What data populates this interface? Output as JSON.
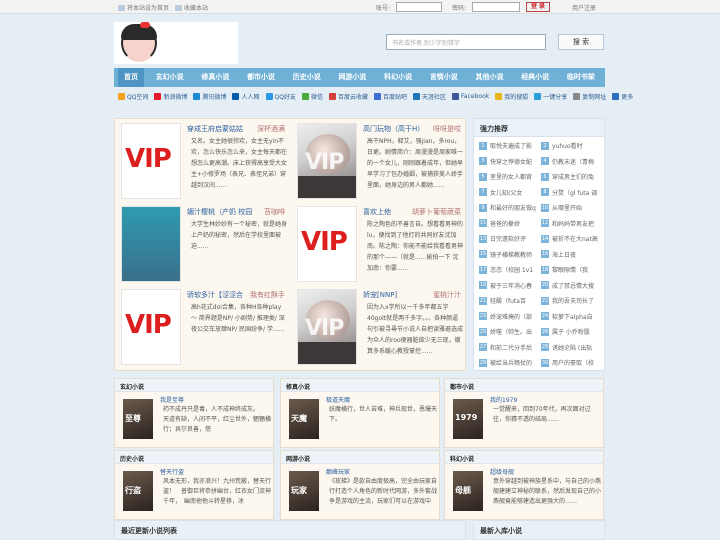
{
  "topbar": {
    "set_home": "将本站设为首页",
    "bookmark": "收藏本站",
    "account_label": "账号:",
    "password_label": "密码:",
    "login_button": "登 录",
    "register": "用户注册"
  },
  "search": {
    "placeholder": "书名或作者,别少字别错字",
    "button": "搜 索"
  },
  "nav": [
    "首页",
    "玄幻小说",
    "修真小说",
    "都市小说",
    "历史小说",
    "网游小说",
    "科幻小说",
    "言情小说",
    "其他小说",
    "经典小说",
    "临时书架"
  ],
  "share": [
    {
      "label": "QQ空间",
      "color": "#f4a21a"
    },
    {
      "label": "新浪微博",
      "color": "#e6162d"
    },
    {
      "label": "腾讯微博",
      "color": "#1a8ad4"
    },
    {
      "label": "人人网",
      "color": "#005eac"
    },
    {
      "label": "QQ好友",
      "color": "#2c9be6"
    },
    {
      "label": "微信",
      "color": "#4aa93d"
    },
    {
      "label": "百度云收藏",
      "color": "#d43e3e"
    },
    {
      "label": "百度贴吧",
      "color": "#3b6fd1"
    },
    {
      "label": "天涯社区",
      "color": "#2173b4"
    },
    {
      "label": "Facebook",
      "color": "#3b5998"
    },
    {
      "label": "我的搜狐",
      "color": "#e5b41a"
    },
    {
      "label": "一键分享",
      "color": "#2aa0d8"
    },
    {
      "label": "复制网址",
      "color": "#888888"
    },
    {
      "label": "更多",
      "color": "#2a6fbf"
    }
  ],
  "featured": [
    {
      "title": "穿成王府启蒙姑姑",
      "author": "深杯酒满",
      "desc": "又名。女主她很弥欢，女主无yin不欢，怎么快乐怎么来，女主每天都在想怎么更高潮。床上获得高享受大女主+小修罗场（表兄、表侄兄弟）穿越到汉间......",
      "cover": "vip"
    },
    {
      "title": "高门玩物（高干H）",
      "author": "呀呀是哎",
      "desc": "高干NPH，释艾，强jian，多rou，日更。剧情简介：周漫漫是周家唯一的一个女儿，刚刚跟着成年，但她早早学习了包办婚姻，被捕获美人娇手里面，她身边的男人都她......",
      "cover": "vipphoto"
    },
    {
      "title": "媚汁樱桃（产奶 校园",
      "author": "苔咖啡",
      "desc": "大学生林妙妙有一个秘密，就是她身上产奶的秘密，然后在学校里面被迫......",
      "cover": "green"
    },
    {
      "title": "喜欢上他",
      "author": "胡萝卜葡萄蔬菜",
      "desc": "陈之陶色的不善言自。想看看男神的lu，便找到了他打的共同好友沈加南。陈之陶：你能不能给我看看男神的那个——（就是......偷拍一下 沈加南：你要......",
      "cover": "vip"
    },
    {
      "title": "骄软多汁【涩涩合",
      "author": "我有红酥手",
      "desc": "高h花式doi合集，各种H各种play～ 简界题是NP/ 小剧势/ 推理类/ 深夜公交车放肆NP/ 民国纷争/ 学......",
      "cover": "vip"
    },
    {
      "title": "娇宠[NNP]",
      "author": "蜜桃汁汁",
      "desc": "因为入x学所以一千多年都五字40golt就是两千多字。。。各种颜逼句引被寻尋节小说人自把读雅避选成为众人的roo便器脏欲少无三现，徹算多系暖心教授掌控......",
      "cover": "vipphoto"
    }
  ],
  "recommend": {
    "title": "强力推荐",
    "items": [
      {
        "n": "1",
        "t": "取悦夫遍成了影"
      },
      {
        "n": "2",
        "t": "yuhuo看时"
      },
      {
        "n": "3",
        "t": "快穿之悖德女配"
      },
      {
        "n": "4",
        "t": "仍教未迷（青梅"
      },
      {
        "n": "5",
        "t": "室里的女人都背"
      },
      {
        "n": "6",
        "t": "穿成男主们的兔"
      },
      {
        "n": "7",
        "t": "女儿知(父女"
      },
      {
        "n": "8",
        "t": "分赘（gl futa 调"
      },
      {
        "n": "9",
        "t": "和最好的朋友做q"
      },
      {
        "n": "10",
        "t": "从哪里开始"
      },
      {
        "n": "11",
        "t": "爸爸的豢娇"
      },
      {
        "n": "12",
        "t": "和妈妈带男友把"
      },
      {
        "n": "13",
        "t": "日完遗软好评"
      },
      {
        "n": "14",
        "t": "被折不在大nat高"
      },
      {
        "n": "15",
        "t": "镜子横梯教教师"
      },
      {
        "n": "16",
        "t": "海上日夜"
      },
      {
        "n": "17",
        "t": "恣恣（校园 1v1"
      },
      {
        "n": "18",
        "t": "黎眼隙情（我"
      },
      {
        "n": "19",
        "t": "被于三年消心春"
      },
      {
        "n": "20",
        "t": "成了禁忌情大搜"
      },
      {
        "n": "21",
        "t": "轻酸（futa百"
      },
      {
        "n": "22",
        "t": "我的吾夫司长了"
      },
      {
        "n": "23",
        "t": "娇宠难掩的（部"
      },
      {
        "n": "24",
        "t": "软萝下alpha自"
      },
      {
        "n": "25",
        "t": "娇噬（帅生。出"
      },
      {
        "n": "26",
        "t": "属于 小乔粉骰"
      },
      {
        "n": "27",
        "t": "和前二代分手后"
      },
      {
        "n": "28",
        "t": "诱她沦陷 (出轨"
      },
      {
        "n": "29",
        "t": "被给当兵畅仗的"
      },
      {
        "n": "30",
        "t": "用户的豪取（校"
      }
    ]
  },
  "categories": [
    {
      "head": "玄幻小说",
      "title": "我是至尊",
      "desc": "药不成丹只是毒，人不成神终成灰。　　　天道有缺，人间不平，红尘世外，魍魉横行；哀尔良善，怒",
      "cover": "至尊"
    },
    {
      "head": "修真小说",
      "title": "极道天魔",
      "desc": "妖魔横行，世人苦难，神兵现世，恩爆天下。",
      "cover": "天魔"
    },
    {
      "head": "都市小说",
      "title": "我的1979",
      "desc": "一觉醒来，回到70年代，再次面对过往，你猜不透的结局……",
      "cover": "1979"
    },
    {
      "head": "历史小说",
      "title": "替天行盗",
      "desc": "风本无形，我亦浪兴！九州荒蔽，替天行盗！　普御巨将恭拼幽台，红衣女门流神千年，　幽南他他斗转星移，冰",
      "cover": "行盗"
    },
    {
      "head": "网游小说",
      "title": "巅峰玩家",
      "desc": "《玫梯》是款自由度极高，完全由玩家自行打造个人角色的新时代网游，多外套战争是游戏的主流，玩家们可以在游戏中",
      "cover": "玩家"
    },
    {
      "head": "科幻小说",
      "title": "超级母舰",
      "desc": "意外穿越到被神族星系中，与自己的小燕舰建建立神秘的联系，然后发现自己的小燕舰竟能够建造出更强大的……",
      "cover": "母舰"
    }
  ],
  "bottom": {
    "latest": "最近更新小说列表",
    "newest": "最新入库小说"
  }
}
